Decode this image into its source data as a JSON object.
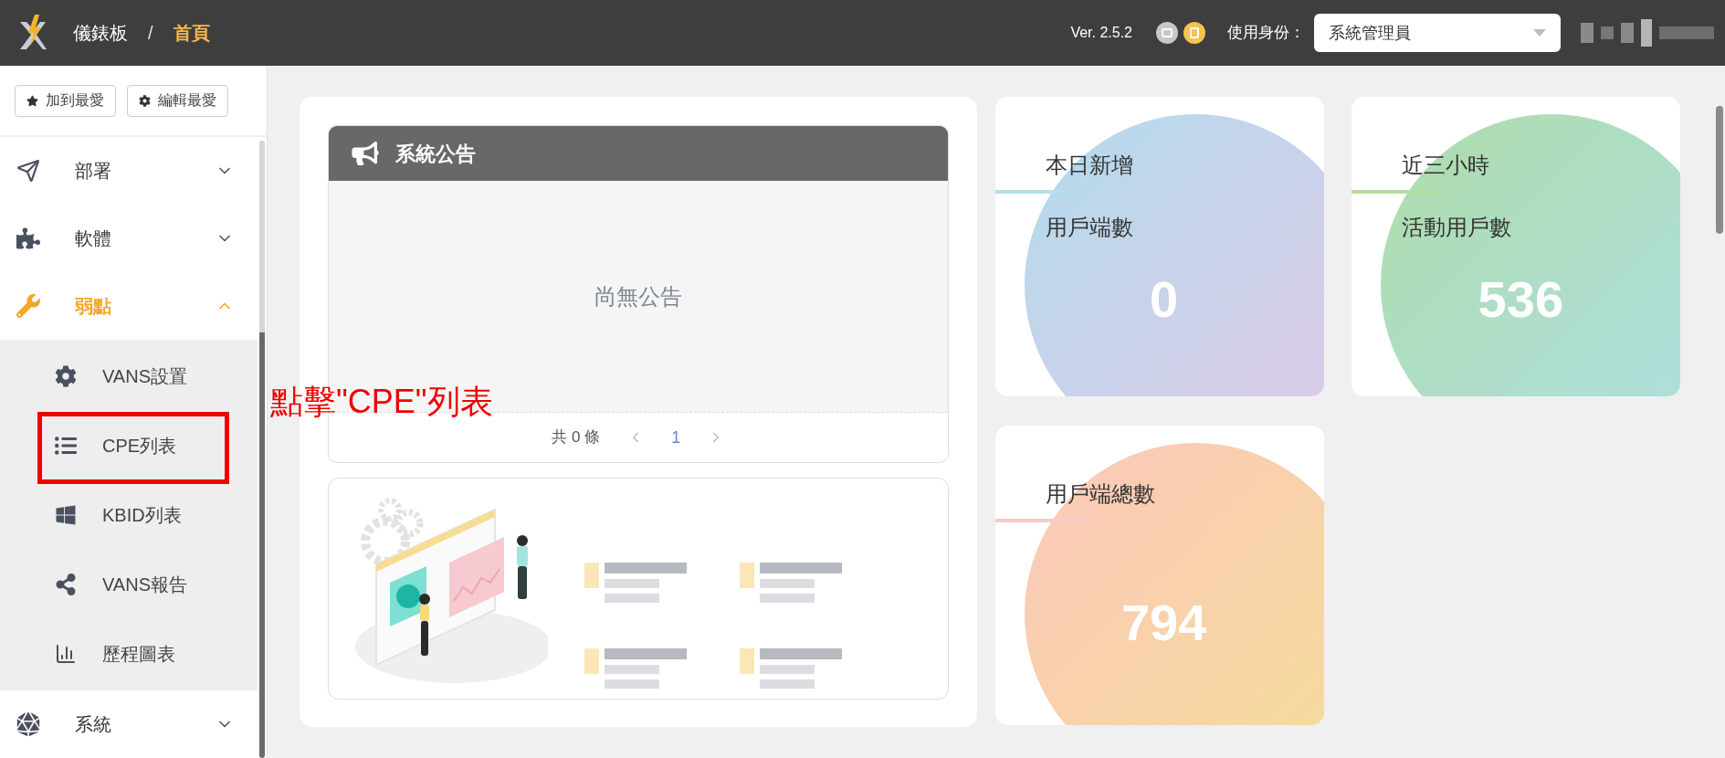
{
  "header": {
    "breadcrumb": [
      {
        "label": "儀錶板",
        "selected": false
      },
      {
        "label": "首頁",
        "selected": true
      }
    ],
    "separator": "/",
    "version": "Ver. 2.5.2",
    "role_label": "使用身份：",
    "role_select": {
      "value": "系統管理員"
    }
  },
  "favorites_buttons": [
    {
      "label": "加到最愛",
      "kind": "star"
    },
    {
      "label": "編輯最愛",
      "kind": "gear"
    }
  ],
  "sidebar": {
    "items": [
      {
        "label": "部署",
        "kind": "plane",
        "expanded": false,
        "selected": false
      },
      {
        "label": "軟體",
        "kind": "puzzle",
        "expanded": false,
        "selected": false
      },
      {
        "label": "弱點",
        "kind": "wrench",
        "expanded": true,
        "selected": true,
        "children": [
          {
            "label": "VANS設置",
            "kind": "gear",
            "selected": false
          },
          {
            "label": "CPE列表",
            "kind": "list",
            "selected": false
          },
          {
            "label": "KBID列表",
            "kind": "windows",
            "selected": false
          },
          {
            "label": "VANS報告",
            "kind": "share",
            "selected": false
          },
          {
            "label": "歷程圖表",
            "kind": "chart",
            "selected": false
          }
        ]
      },
      {
        "label": "系統",
        "kind": "polyhedron",
        "expanded": false,
        "selected": false
      }
    ]
  },
  "announcement": {
    "title": "系統公告",
    "empty_text": "尚無公告",
    "total": "共 0 條",
    "pages": [
      {
        "label": "1",
        "selected": true
      }
    ]
  },
  "stats": [
    {
      "title": "本日新增",
      "subtitle": "用戶端數",
      "value": "0",
      "kind": "blue"
    },
    {
      "title": "近三小時",
      "subtitle": "活動用戶數",
      "value": "536",
      "kind": "green"
    },
    {
      "title": "用戶端總數",
      "value": "794",
      "kind": "orange"
    }
  ],
  "annotation": {
    "text": "點擊\"CPE\"列表"
  }
}
